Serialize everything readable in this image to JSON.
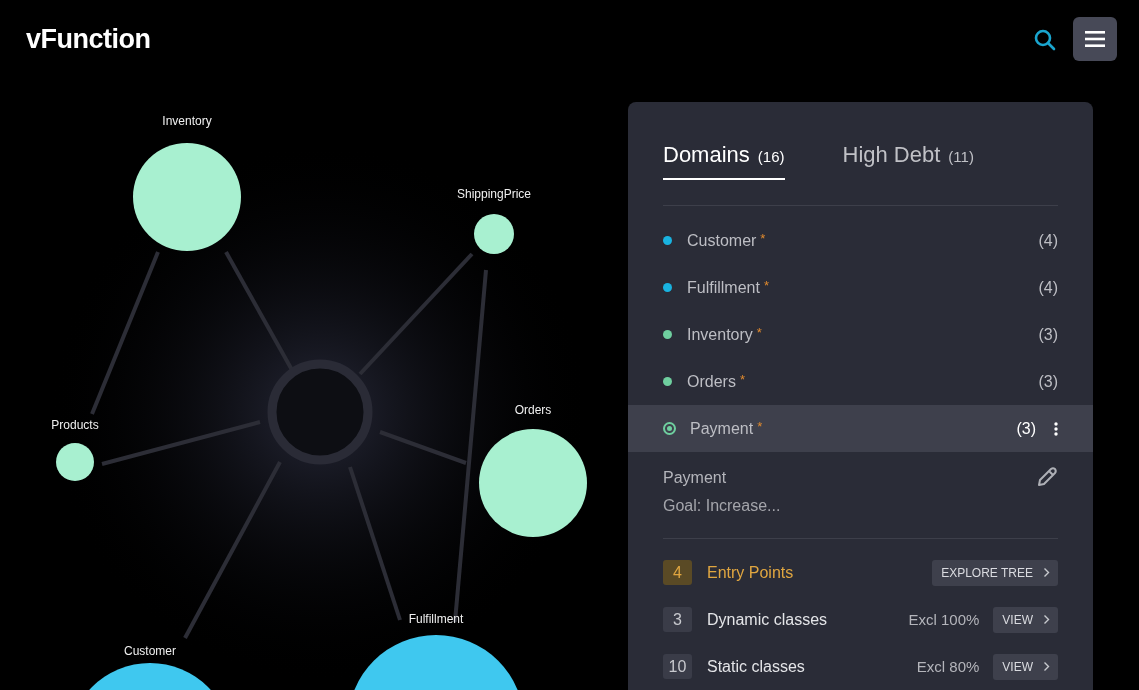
{
  "header": {
    "logo": "vFunction"
  },
  "graph": {
    "nodes": [
      {
        "name": "Inventory",
        "color": "#a8f0d0"
      },
      {
        "name": "ShippingPrice",
        "color": "#a8f0d0"
      },
      {
        "name": "Products",
        "color": "#a8f0d0"
      },
      {
        "name": "Orders",
        "color": "#a8f0d0"
      },
      {
        "name": "Customer",
        "color": "#3fc8ef"
      },
      {
        "name": "Fulfillment",
        "color": "#3fc8ef"
      }
    ]
  },
  "panel": {
    "tabs": [
      {
        "label": "Domains",
        "count": "(16)",
        "selected": true
      },
      {
        "label": "High Debt",
        "count": "(11)",
        "selected": false
      }
    ],
    "domains": [
      {
        "name": "Customer",
        "mark": "*",
        "count": "(4)",
        "color": "#19b3e0",
        "selected": false
      },
      {
        "name": "Fulfillment",
        "mark": "*",
        "count": "(4)",
        "color": "#19b3e0",
        "selected": false
      },
      {
        "name": "Inventory",
        "mark": "*",
        "count": "(3)",
        "color": "#6fcf9f",
        "selected": false
      },
      {
        "name": "Orders",
        "mark": "*",
        "count": "(3)",
        "color": "#6fcf9f",
        "selected": false
      },
      {
        "name": "Payment",
        "mark": "*",
        "count": "(3)",
        "color": "#6fcf9f",
        "selected": true
      }
    ],
    "detail": {
      "title": "Payment",
      "goal": "Goal: Increase...",
      "metrics": [
        {
          "count": "4",
          "label": "Entry Points",
          "highlighted": true,
          "button": "EXPLORE TREE"
        },
        {
          "count": "3",
          "label": "Dynamic classes",
          "highlighted": false,
          "excl": "Excl 100%",
          "button": "VIEW"
        },
        {
          "count": "10",
          "label": "Static classes",
          "highlighted": false,
          "excl": "Excl 80%",
          "button": "VIEW"
        }
      ]
    }
  }
}
